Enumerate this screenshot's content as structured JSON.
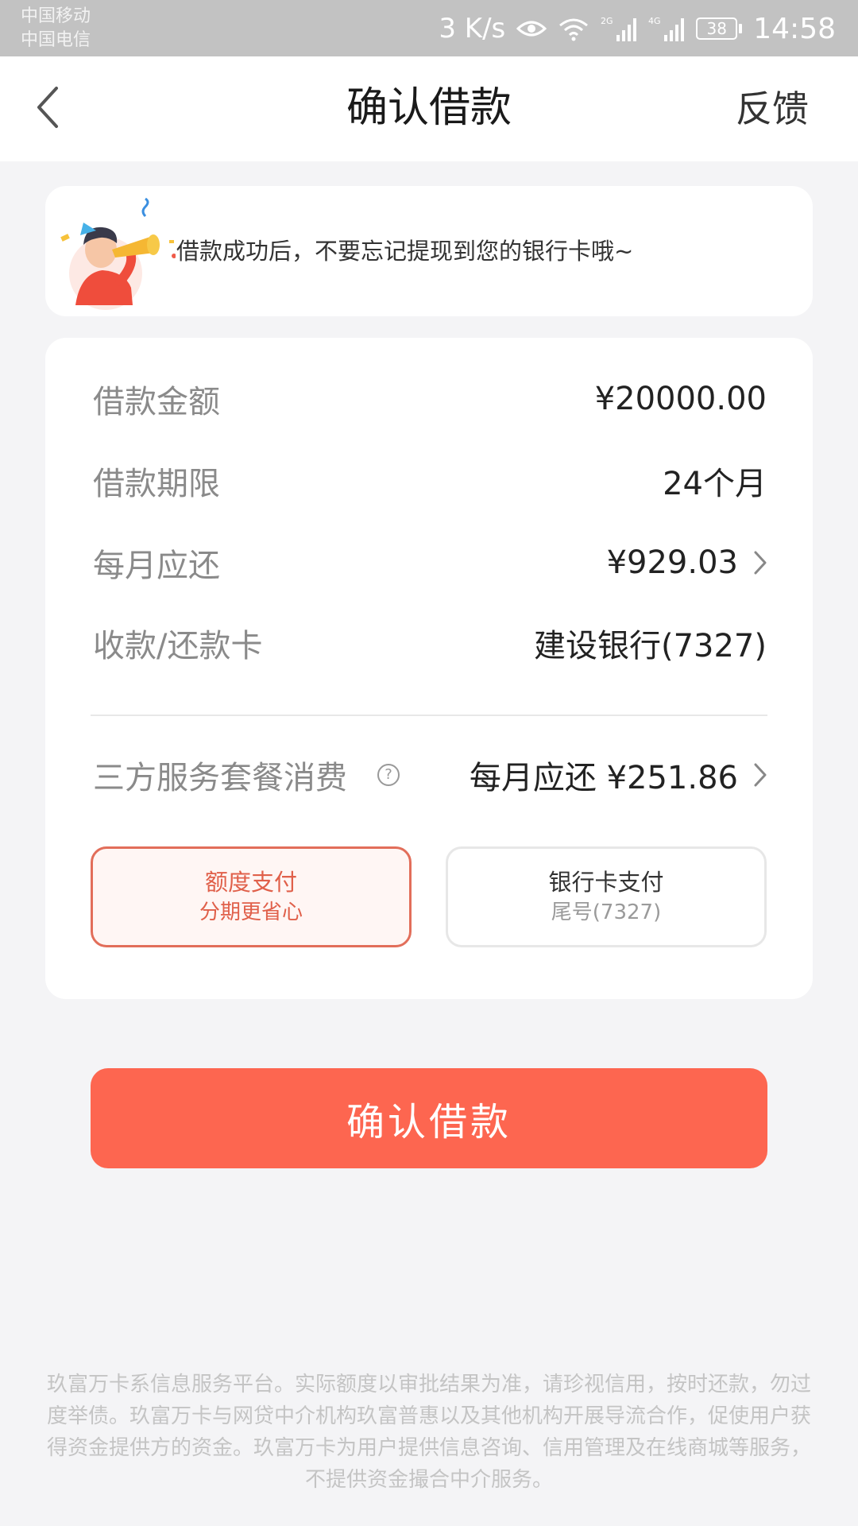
{
  "status_bar": {
    "carrier_1": "中国移动",
    "carrier_2": "中国电信",
    "network_speed": "3 K/s",
    "signal_1_label": "2G",
    "signal_2_label": "4G",
    "battery_level": "38",
    "time": "14:58"
  },
  "nav": {
    "title": "确认借款",
    "feedback_label": "反馈"
  },
  "notice": {
    "text": "借款成功后，不要忘记提现到您的银行卡哦~"
  },
  "details": {
    "amount_label": "借款金额",
    "amount_value": "¥20000.00",
    "term_label": "借款期限",
    "term_value": "24个月",
    "monthly_label": "每月应还",
    "monthly_value": "¥929.03",
    "card_label": "收款/还款卡",
    "card_value": "建设银行(7327)",
    "service_label": "三方服务套餐消费",
    "service_help_glyph": "?",
    "service_value": "每月应还 ¥251.86"
  },
  "payment_options": {
    "quota_title": "额度支付",
    "quota_subtitle": "分期更省心",
    "card_title": "银行卡支付",
    "card_subtitle": "尾号(7327)"
  },
  "confirm_button_label": "确认借款",
  "disclaimer": "玖富万卡系信息服务平台。实际额度以审批结果为准，请珍视信用，按时还款，勿过度举债。玖富万卡与网贷中介机构玖富普惠以及其他机构开展导流合作，促使用户获得资金提供方的资金。玖富万卡为用户提供信息咨询、信用管理及在线商城等服务，不提供资金撮合中介服务。",
  "colors": {
    "accent": "#fd6650",
    "selected_border": "#e26e5a",
    "page_background": "#f4f4f6",
    "status_bar": "#c2c2c2"
  },
  "icons": [
    "back-arrow-icon",
    "eye-icon",
    "wifi-icon",
    "signal-icon",
    "battery-icon",
    "help-icon",
    "chevron-right-icon",
    "mascot-trumpet-illustration"
  ]
}
